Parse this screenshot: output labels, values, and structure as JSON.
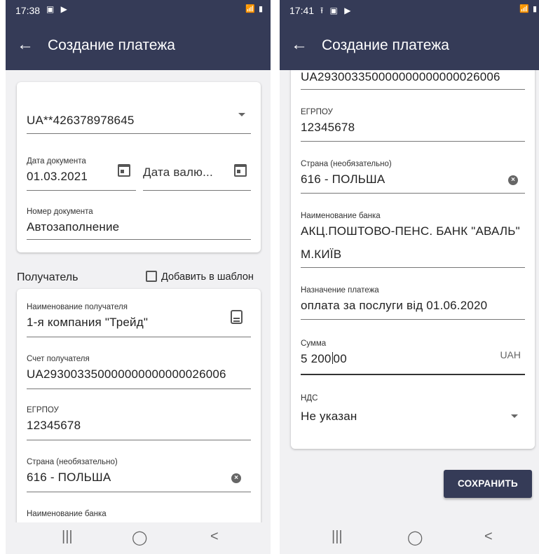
{
  "left": {
    "status": {
      "time": "17:38",
      "left_icons": "▣ ▶",
      "right_icons": "📶 ▮"
    },
    "appbar": {
      "back_icon": "arrow-left-icon",
      "title": "Создание платежа"
    },
    "account": {
      "value": "UA**426378978645"
    },
    "doc_date": {
      "label": "Дата документа",
      "value": "01.03.2021"
    },
    "value_date": {
      "placeholder": "Дата валю..."
    },
    "doc_number": {
      "label": "Номер документа",
      "value": "Автозаполнение"
    },
    "recipient_section": {
      "title": "Получатель",
      "template_label": "Добавить в шаблон",
      "template_checked": false
    },
    "recipient_name": {
      "label": "Наименование получателя",
      "value": "1-я компания \"Трейд\""
    },
    "recipient_account": {
      "label": "Счет получателя",
      "value": "UA293003350000000000000026006"
    },
    "edrpou": {
      "label": "ЕГРПОУ",
      "value": "12345678"
    },
    "country": {
      "label": "Страна (необязательно)",
      "value": "616 - ПОЛЬША"
    },
    "bank_name": {
      "label": "Наименование банка"
    },
    "navbar": {
      "recents": "|||",
      "home": "◯",
      "back": "<"
    }
  },
  "right": {
    "status": {
      "time": "17:41",
      "left_icons": "⭱ ▣ ▶",
      "right_icons": "📶 ▮"
    },
    "appbar": {
      "back_icon": "arrow-left-icon",
      "title": "Создание платежа"
    },
    "recipient_account": {
      "value": "UA293003350000000000000026006"
    },
    "edrpou": {
      "label": "ЕГРПОУ",
      "value": "12345678"
    },
    "country": {
      "label": "Страна (необязательно)",
      "value": "616 - ПОЛЬША"
    },
    "bank_name": {
      "label": "Наименование банка",
      "value_line1": "АКЦ.ПОШТОВО-ПЕНС. БАНК \"АВАЛЬ\"",
      "value_line2": "М.КИЇВ"
    },
    "purpose": {
      "label": "Назначение платежа",
      "value": "оплата за послуги від 01.06.2020"
    },
    "amount": {
      "label": "Сумма",
      "value_before_cursor": "5 200",
      "value_after_cursor": "00",
      "currency": "UAH"
    },
    "vat": {
      "label": "НДС",
      "value": "Не указан"
    },
    "save_button": "СОХРАНИТЬ",
    "navbar": {
      "recents": "|||",
      "home": "◯",
      "back": "<"
    }
  },
  "colors": {
    "appbar": "#353b57",
    "background": "#f1f1f3",
    "card": "#ffffff",
    "button": "#353b57"
  }
}
